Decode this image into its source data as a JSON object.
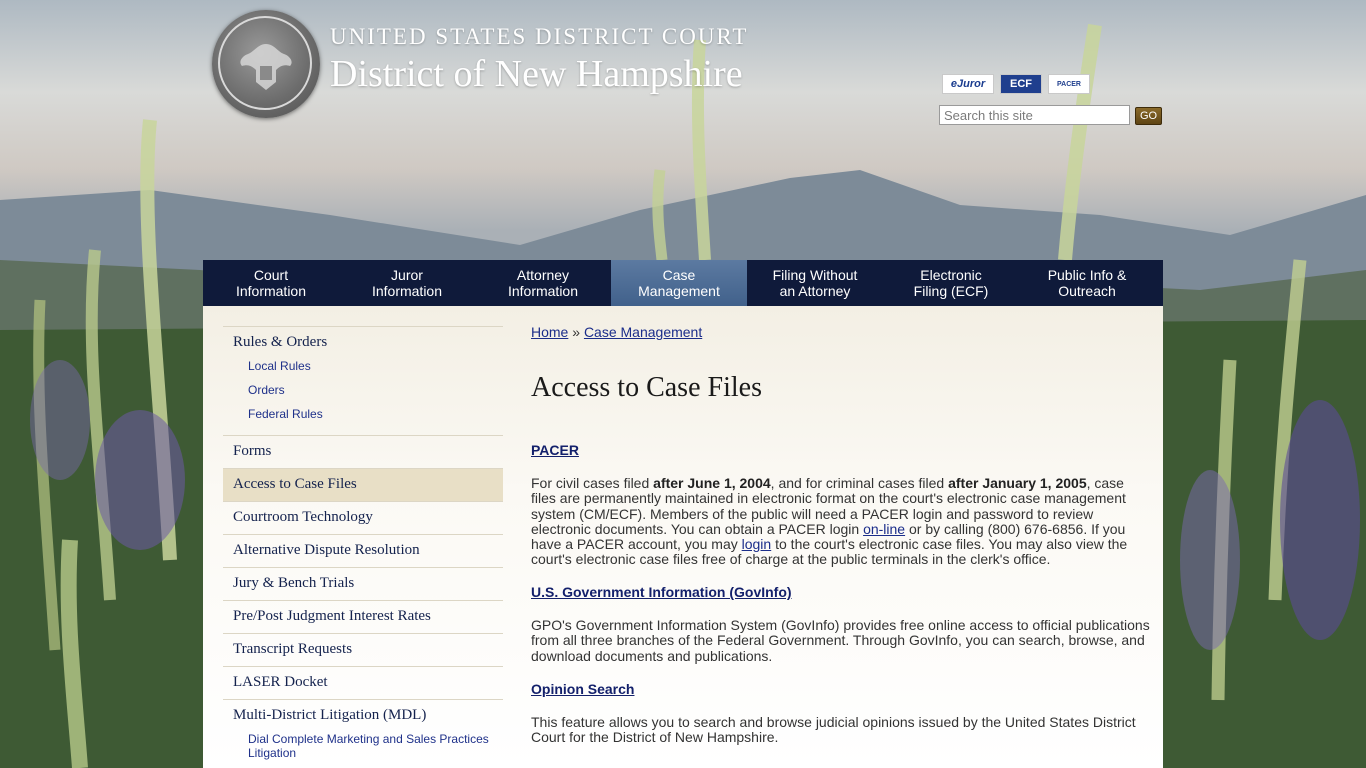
{
  "header": {
    "court_line1": "United States District Court",
    "court_line2": "District of New Hampshire",
    "quick_links": [
      "eJuror",
      "ECF",
      "PACER"
    ],
    "search_placeholder": "Search this site",
    "go_label": "GO"
  },
  "nav": {
    "items": [
      {
        "label": "Court\nInformation",
        "active": false
      },
      {
        "label": "Juror\nInformation",
        "active": false
      },
      {
        "label": "Attorney\nInformation",
        "active": false
      },
      {
        "label": "Case\nManagement",
        "active": true
      },
      {
        "label": "Filing Without\nan Attorney",
        "active": false
      },
      {
        "label": "Electronic\nFiling (ECF)",
        "active": false
      },
      {
        "label": "Public Info &\nOutreach",
        "active": false
      }
    ]
  },
  "sidebar": {
    "rules_orders": "Rules & Orders",
    "rules_sub": [
      "Local Rules",
      "Orders",
      "Federal Rules"
    ],
    "forms": "Forms",
    "access": "Access to Case Files",
    "courtroom": "Courtroom Technology",
    "adr": "Alternative Dispute Resolution",
    "jury": "Jury & Bench Trials",
    "interest": "Pre/Post Judgment Interest Rates",
    "transcript": "Transcript Requests",
    "laser": "LASER Docket",
    "mdl": "Multi-District Litigation (MDL)",
    "mdl_sub": "Dial Complete Marketing and Sales Practices Litigation"
  },
  "main": {
    "breadcrumb_home": "Home",
    "breadcrumb_sep": "»",
    "breadcrumb_current": "Case Management",
    "title": "Access to Case Files",
    "pacer_heading": "PACER",
    "pacer_p1": "For civil cases filed ",
    "pacer_b1": "after June 1, 2004",
    "pacer_p2": ", and for criminal cases filed ",
    "pacer_b2": "after January 1, 2005",
    "pacer_p3": ", case files are permanently maintained in electronic format on the court's electronic case management system (CM/ECF). Members of the public will need a PACER login and password to review electronic documents. You can obtain a PACER login ",
    "pacer_link1": "on-line",
    "pacer_p4": " or by calling (800) 676-6856. If you have a PACER account, you may ",
    "pacer_link2": "login",
    "pacer_p5": " to the court's electronic case files. You may also view the court's electronic case files free of charge at the public terminals in the clerk's office.",
    "govinfo_heading": "U.S. Government Information (GovInfo)",
    "govinfo_text": "GPO's Government Information System (GovInfo) provides free online access to official publications from all three branches of the Federal Government. Through GovInfo, you can search, browse, and download documents and publications.",
    "opinion_heading": "Opinion Search",
    "opinion_text": "This feature allows you to search and browse judicial opinions issued by the United States District Court for the District of New Hampshire."
  }
}
